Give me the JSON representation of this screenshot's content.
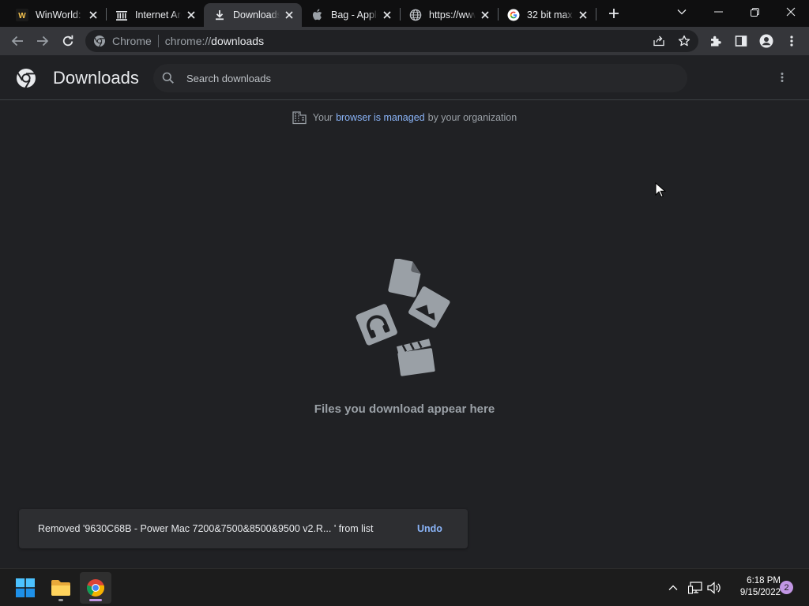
{
  "browser": {
    "tabs": [
      {
        "title": "WinWorld: ",
        "icon": "winworld-icon",
        "active": false
      },
      {
        "title": "Internet Arc",
        "icon": "internet-archive-icon",
        "active": false
      },
      {
        "title": "Downloads",
        "icon": "download-icon",
        "active": true
      },
      {
        "title": "Bag - Apple",
        "icon": "apple-icon",
        "active": false
      },
      {
        "title": "https://www",
        "icon": "globe-icon",
        "active": false
      },
      {
        "title": "32 bit max",
        "icon": "google-icon",
        "active": false
      }
    ],
    "omnibox": {
      "chip": "Chrome",
      "scheme": "chrome://",
      "host": "downloads"
    }
  },
  "page": {
    "title": "Downloads",
    "search_placeholder": "Search downloads",
    "managed": {
      "before": "Your",
      "link": "browser is managed",
      "after": "by your organization"
    },
    "empty_message": "Files you download appear here"
  },
  "toast": {
    "message": "Removed '9630C68B - Power Mac 7200&7500&8500&9500 v2.R... ' from list",
    "undo_label": "Undo"
  },
  "taskbar": {
    "apps": [
      "start-button",
      "file-explorer",
      "chrome"
    ],
    "time": "6:18 PM",
    "date": "9/15/2022",
    "notification_count": "2"
  },
  "colors": {
    "accent_link": "#8ab4f8",
    "page_bg": "#202124",
    "toolbar_bg": "#35363a",
    "tab_strip_bg": "#0f0f10",
    "taskbar_bg": "#1c1c1c"
  }
}
